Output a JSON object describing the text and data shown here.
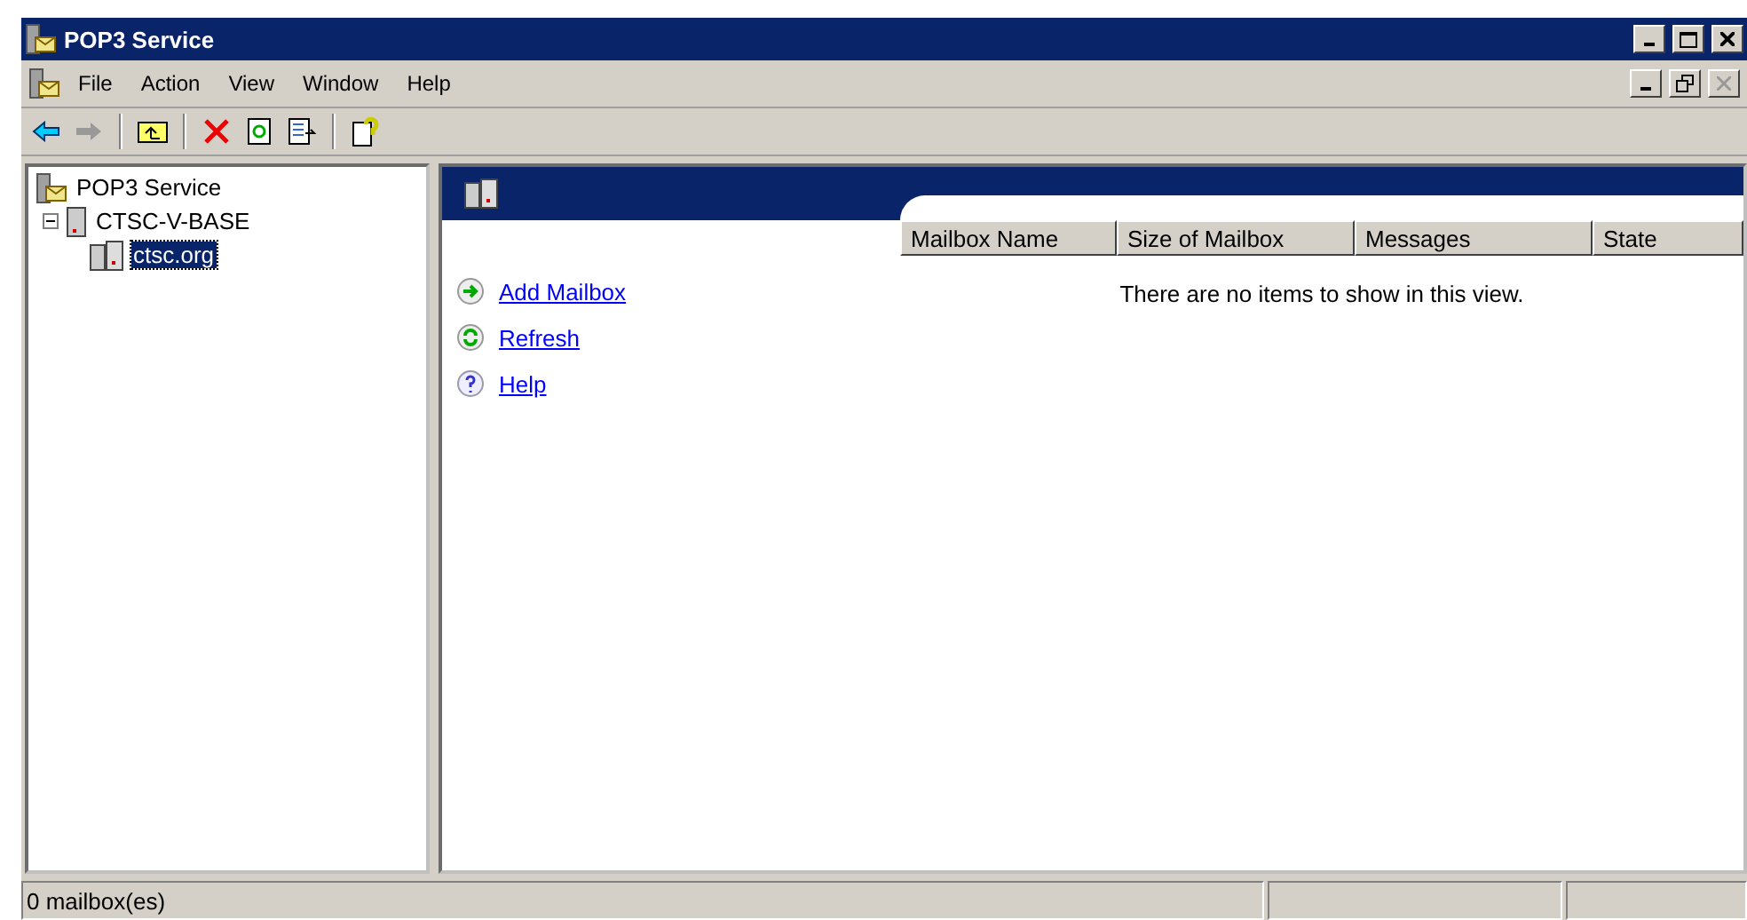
{
  "window": {
    "title": "POP3 Service"
  },
  "menu": [
    "File",
    "Action",
    "View",
    "Window",
    "Help"
  ],
  "tree": [
    {
      "label": "POP3 Service",
      "kind": "root",
      "selected": false,
      "children": [
        {
          "label": "CTSC-V-BASE",
          "kind": "server",
          "expanded": true,
          "selected": false,
          "children": [
            {
              "label": "ctsc.org",
              "kind": "domain",
              "selected": true
            }
          ]
        }
      ]
    }
  ],
  "tasks": [
    {
      "label": "Add Mailbox",
      "kind": "add"
    },
    {
      "label": "Refresh",
      "kind": "refresh"
    },
    {
      "label": "Help",
      "kind": "help"
    }
  ],
  "table": {
    "columns": [
      "Mailbox Name",
      "Size of Mailbox",
      "Messages",
      "State"
    ],
    "empty_text": "There are no items to show in this view."
  },
  "status_bar": {
    "text": "0 mailbox(es)"
  }
}
